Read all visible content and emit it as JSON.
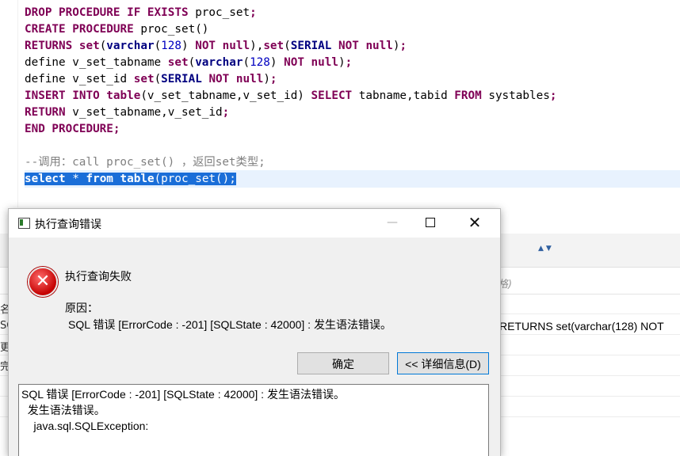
{
  "editor": {
    "lines": [
      [
        {
          "c": "kw",
          "t": "DROP PROCEDURE IF EXISTS"
        },
        {
          "c": "pl",
          "t": " proc_set"
        },
        {
          "c": "kw",
          "t": ";"
        }
      ],
      [
        {
          "c": "kw",
          "t": "CREATE PROCEDURE"
        },
        {
          "c": "pl",
          "t": " proc_set()"
        }
      ],
      [
        {
          "c": "kw",
          "t": "RETURNS set"
        },
        {
          "c": "pl",
          "t": "("
        },
        {
          "c": "ty",
          "t": "varchar"
        },
        {
          "c": "pl",
          "t": "("
        },
        {
          "c": "num",
          "t": "128"
        },
        {
          "c": "pl",
          "t": ") "
        },
        {
          "c": "kw",
          "t": "NOT null"
        },
        {
          "c": "pl",
          "t": "),"
        },
        {
          "c": "kw",
          "t": "set"
        },
        {
          "c": "pl",
          "t": "("
        },
        {
          "c": "ty",
          "t": "SERIAL"
        },
        {
          "c": "pl",
          "t": " "
        },
        {
          "c": "kw",
          "t": "NOT null"
        },
        {
          "c": "pl",
          "t": ")"
        },
        {
          "c": "kw",
          "t": ";"
        }
      ],
      [
        {
          "c": "pl",
          "t": "define v_set_tabname "
        },
        {
          "c": "kw",
          "t": "set"
        },
        {
          "c": "pl",
          "t": "("
        },
        {
          "c": "ty",
          "t": "varchar"
        },
        {
          "c": "pl",
          "t": "("
        },
        {
          "c": "num",
          "t": "128"
        },
        {
          "c": "pl",
          "t": ") "
        },
        {
          "c": "kw",
          "t": "NOT null"
        },
        {
          "c": "pl",
          "t": ")"
        },
        {
          "c": "kw",
          "t": ";"
        }
      ],
      [
        {
          "c": "pl",
          "t": "define v_set_id "
        },
        {
          "c": "kw",
          "t": "set"
        },
        {
          "c": "pl",
          "t": "("
        },
        {
          "c": "ty",
          "t": "SERIAL"
        },
        {
          "c": "pl",
          "t": " "
        },
        {
          "c": "kw",
          "t": "NOT null"
        },
        {
          "c": "pl",
          "t": ")"
        },
        {
          "c": "kw",
          "t": ";"
        }
      ],
      [
        {
          "c": "kw",
          "t": "INSERT INTO table"
        },
        {
          "c": "pl",
          "t": "(v_set_tabname,v_set_id) "
        },
        {
          "c": "kw",
          "t": "SELECT"
        },
        {
          "c": "pl",
          "t": " tabname,tabid "
        },
        {
          "c": "kw",
          "t": "FROM"
        },
        {
          "c": "pl",
          "t": " systables"
        },
        {
          "c": "kw",
          "t": ";"
        }
      ],
      [
        {
          "c": "kw",
          "t": "RETURN"
        },
        {
          "c": "pl",
          "t": " v_set_tabname,v_set_id"
        },
        {
          "c": "kw",
          "t": ";"
        }
      ],
      [
        {
          "c": "kw",
          "t": "END PROCEDURE"
        },
        {
          "c": "kw",
          "t": ";"
        }
      ],
      [],
      [
        {
          "c": "cm",
          "t": "--调用：call proc_set() ，返回set类型;"
        }
      ],
      [
        {
          "c": "kw",
          "t": "select"
        },
        {
          "c": "pl",
          "t": " * "
        },
        {
          "c": "kw",
          "t": "from table"
        },
        {
          "c": "pl",
          "t": "(proc_set();"
        }
      ]
    ]
  },
  "background": {
    "filter_hint": "格)",
    "result_row_text": "RETURNS set(varchar(128) NOT",
    "left_fragments": [
      "名",
      "SQ",
      "更",
      "完"
    ]
  },
  "dialog": {
    "title": "执行查询错误",
    "heading": "执行查询失败",
    "reason_label": "原因：",
    "reason_text": "SQL 错误 [ErrorCode : -201]  [SQLState : 42000] : 发生语法错误。",
    "ok_label": "确定",
    "detail_label": "<< 详细信息(D)",
    "details": [
      "SQL 错误 [ErrorCode : -201]  [SQLState : 42000] : 发生语法错误。",
      "  发生语法错误。",
      "    java.sql.SQLException:"
    ],
    "error_glyph": "x-icon"
  },
  "colors": {
    "keyword": "#7f0055",
    "type": "#000080",
    "number": "#0000c0",
    "comment": "#808080",
    "selection": "#1a6ed8"
  }
}
